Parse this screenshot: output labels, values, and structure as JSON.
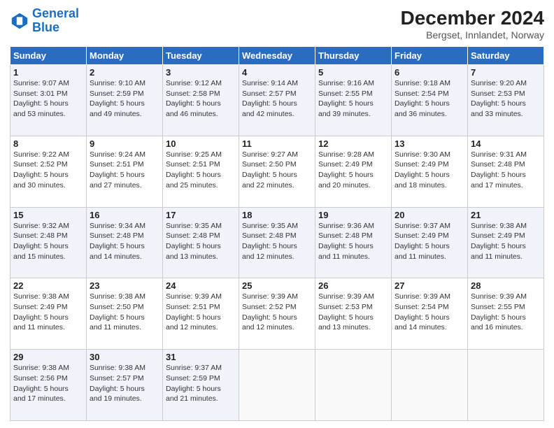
{
  "header": {
    "logo_line1": "General",
    "logo_line2": "Blue",
    "title": "December 2024",
    "subtitle": "Bergset, Innlandet, Norway"
  },
  "days_of_week": [
    "Sunday",
    "Monday",
    "Tuesday",
    "Wednesday",
    "Thursday",
    "Friday",
    "Saturday"
  ],
  "weeks": [
    [
      {
        "num": "1",
        "info": "Sunrise: 9:07 AM\nSunset: 3:01 PM\nDaylight: 5 hours\nand 53 minutes."
      },
      {
        "num": "2",
        "info": "Sunrise: 9:10 AM\nSunset: 2:59 PM\nDaylight: 5 hours\nand 49 minutes."
      },
      {
        "num": "3",
        "info": "Sunrise: 9:12 AM\nSunset: 2:58 PM\nDaylight: 5 hours\nand 46 minutes."
      },
      {
        "num": "4",
        "info": "Sunrise: 9:14 AM\nSunset: 2:57 PM\nDaylight: 5 hours\nand 42 minutes."
      },
      {
        "num": "5",
        "info": "Sunrise: 9:16 AM\nSunset: 2:55 PM\nDaylight: 5 hours\nand 39 minutes."
      },
      {
        "num": "6",
        "info": "Sunrise: 9:18 AM\nSunset: 2:54 PM\nDaylight: 5 hours\nand 36 minutes."
      },
      {
        "num": "7",
        "info": "Sunrise: 9:20 AM\nSunset: 2:53 PM\nDaylight: 5 hours\nand 33 minutes."
      }
    ],
    [
      {
        "num": "8",
        "info": "Sunrise: 9:22 AM\nSunset: 2:52 PM\nDaylight: 5 hours\nand 30 minutes."
      },
      {
        "num": "9",
        "info": "Sunrise: 9:24 AM\nSunset: 2:51 PM\nDaylight: 5 hours\nand 27 minutes."
      },
      {
        "num": "10",
        "info": "Sunrise: 9:25 AM\nSunset: 2:51 PM\nDaylight: 5 hours\nand 25 minutes."
      },
      {
        "num": "11",
        "info": "Sunrise: 9:27 AM\nSunset: 2:50 PM\nDaylight: 5 hours\nand 22 minutes."
      },
      {
        "num": "12",
        "info": "Sunrise: 9:28 AM\nSunset: 2:49 PM\nDaylight: 5 hours\nand 20 minutes."
      },
      {
        "num": "13",
        "info": "Sunrise: 9:30 AM\nSunset: 2:49 PM\nDaylight: 5 hours\nand 18 minutes."
      },
      {
        "num": "14",
        "info": "Sunrise: 9:31 AM\nSunset: 2:48 PM\nDaylight: 5 hours\nand 17 minutes."
      }
    ],
    [
      {
        "num": "15",
        "info": "Sunrise: 9:32 AM\nSunset: 2:48 PM\nDaylight: 5 hours\nand 15 minutes."
      },
      {
        "num": "16",
        "info": "Sunrise: 9:34 AM\nSunset: 2:48 PM\nDaylight: 5 hours\nand 14 minutes."
      },
      {
        "num": "17",
        "info": "Sunrise: 9:35 AM\nSunset: 2:48 PM\nDaylight: 5 hours\nand 13 minutes."
      },
      {
        "num": "18",
        "info": "Sunrise: 9:35 AM\nSunset: 2:48 PM\nDaylight: 5 hours\nand 12 minutes."
      },
      {
        "num": "19",
        "info": "Sunrise: 9:36 AM\nSunset: 2:48 PM\nDaylight: 5 hours\nand 11 minutes."
      },
      {
        "num": "20",
        "info": "Sunrise: 9:37 AM\nSunset: 2:49 PM\nDaylight: 5 hours\nand 11 minutes."
      },
      {
        "num": "21",
        "info": "Sunrise: 9:38 AM\nSunset: 2:49 PM\nDaylight: 5 hours\nand 11 minutes."
      }
    ],
    [
      {
        "num": "22",
        "info": "Sunrise: 9:38 AM\nSunset: 2:49 PM\nDaylight: 5 hours\nand 11 minutes."
      },
      {
        "num": "23",
        "info": "Sunrise: 9:38 AM\nSunset: 2:50 PM\nDaylight: 5 hours\nand 11 minutes."
      },
      {
        "num": "24",
        "info": "Sunrise: 9:39 AM\nSunset: 2:51 PM\nDaylight: 5 hours\nand 12 minutes."
      },
      {
        "num": "25",
        "info": "Sunrise: 9:39 AM\nSunset: 2:52 PM\nDaylight: 5 hours\nand 12 minutes."
      },
      {
        "num": "26",
        "info": "Sunrise: 9:39 AM\nSunset: 2:53 PM\nDaylight: 5 hours\nand 13 minutes."
      },
      {
        "num": "27",
        "info": "Sunrise: 9:39 AM\nSunset: 2:54 PM\nDaylight: 5 hours\nand 14 minutes."
      },
      {
        "num": "28",
        "info": "Sunrise: 9:39 AM\nSunset: 2:55 PM\nDaylight: 5 hours\nand 16 minutes."
      }
    ],
    [
      {
        "num": "29",
        "info": "Sunrise: 9:38 AM\nSunset: 2:56 PM\nDaylight: 5 hours\nand 17 minutes."
      },
      {
        "num": "30",
        "info": "Sunrise: 9:38 AM\nSunset: 2:57 PM\nDaylight: 5 hours\nand 19 minutes."
      },
      {
        "num": "31",
        "info": "Sunrise: 9:37 AM\nSunset: 2:59 PM\nDaylight: 5 hours\nand 21 minutes."
      },
      null,
      null,
      null,
      null
    ]
  ]
}
